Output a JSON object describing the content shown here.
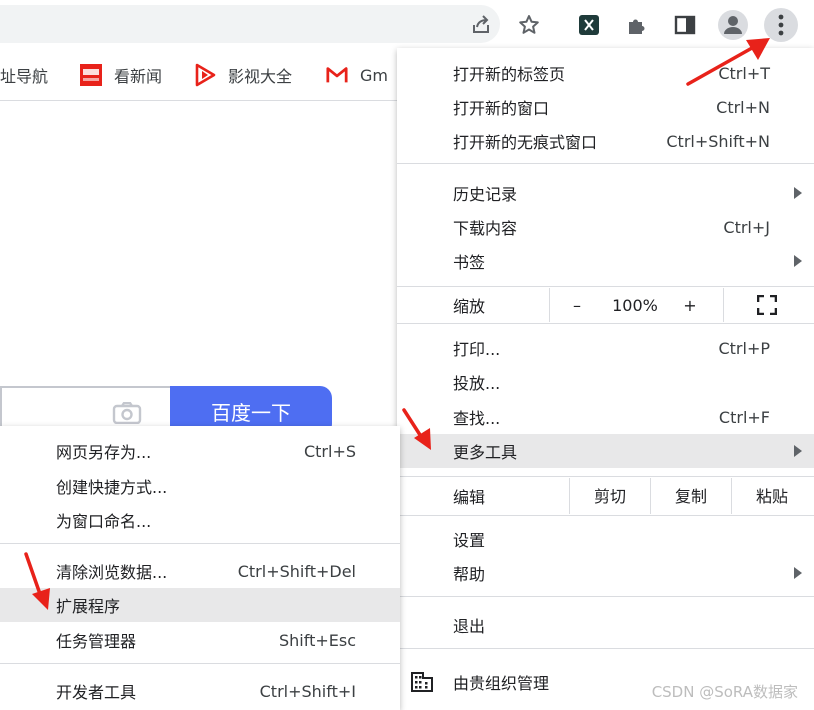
{
  "colors": {
    "accent_red": "#e8221a",
    "search_button": "#4e6ef2",
    "highlight": "#e8e8e9"
  },
  "bookmarks": [
    {
      "label": "址导航",
      "icon": "partial-icon"
    },
    {
      "label": "看新闻",
      "icon": "toutiao-icon"
    },
    {
      "label": "影视大全",
      "icon": "play-icon"
    },
    {
      "label": "Gm",
      "icon": "gmail-icon"
    }
  ],
  "toolbar_icons": [
    "share-icon",
    "star-icon",
    "x-extension-icon",
    "puzzle-icon",
    "sidepanel-icon",
    "profile-icon",
    "kebab-menu-icon"
  ],
  "page": {
    "search_button": "百度一下"
  },
  "main_menu": {
    "new_tab": {
      "label": "打开新的标签页",
      "shortcut": "Ctrl+T"
    },
    "new_window": {
      "label": "打开新的窗口",
      "shortcut": "Ctrl+N"
    },
    "incognito": {
      "label": "打开新的无痕式窗口",
      "shortcut": "Ctrl+Shift+N"
    },
    "history": {
      "label": "历史记录"
    },
    "downloads": {
      "label": "下载内容",
      "shortcut": "Ctrl+J"
    },
    "bookmarks": {
      "label": "书签"
    },
    "zoom": {
      "label": "缩放",
      "minus": "–",
      "value": "100%",
      "plus": "+"
    },
    "print": {
      "label": "打印...",
      "shortcut": "Ctrl+P"
    },
    "cast": {
      "label": "投放..."
    },
    "find": {
      "label": "查找...",
      "shortcut": "Ctrl+F"
    },
    "more_tools": {
      "label": "更多工具"
    },
    "edit": {
      "label": "编辑",
      "cut": "剪切",
      "copy": "复制",
      "paste": "粘贴"
    },
    "settings": {
      "label": "设置"
    },
    "help": {
      "label": "帮助"
    },
    "exit": {
      "label": "退出"
    },
    "managed": {
      "label": "由贵组织管理"
    }
  },
  "sub_menu": {
    "save_page": {
      "label": "网页另存为...",
      "shortcut": "Ctrl+S"
    },
    "create_shortcut": {
      "label": "创建快捷方式..."
    },
    "name_window": {
      "label": "为窗口命名..."
    },
    "clear_data": {
      "label": "清除浏览数据...",
      "shortcut": "Ctrl+Shift+Del"
    },
    "extensions": {
      "label": "扩展程序"
    },
    "task_manager": {
      "label": "任务管理器",
      "shortcut": "Shift+Esc"
    },
    "dev_tools": {
      "label": "开发者工具",
      "shortcut": "Ctrl+Shift+I"
    }
  },
  "watermark": "CSDN @SoRA数据家"
}
